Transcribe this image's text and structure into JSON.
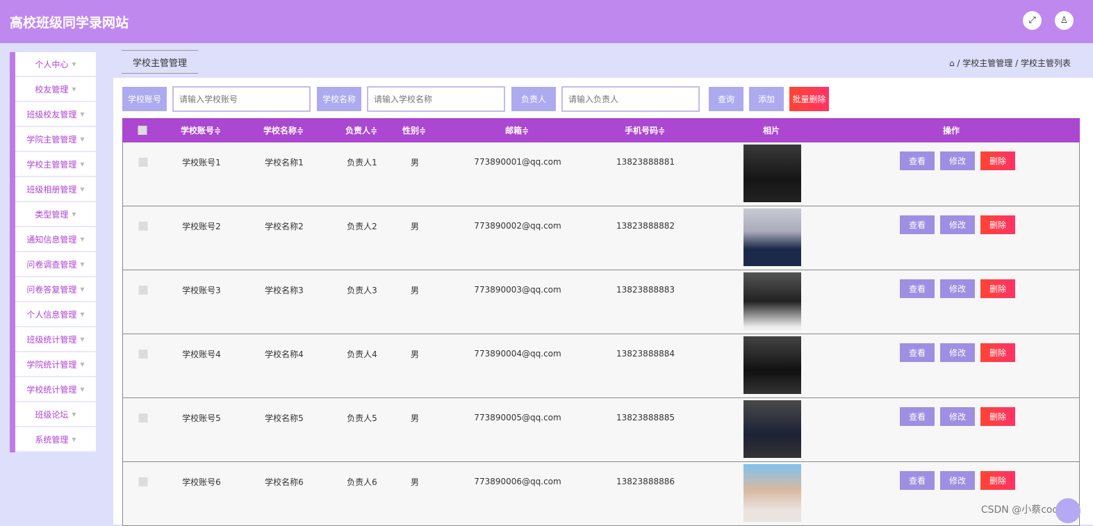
{
  "header": {
    "title": "高校班级同学录网站"
  },
  "sidebar": {
    "items": [
      "个人中心",
      "校友管理",
      "班级校友管理",
      "学院主管管理",
      "学校主管管理",
      "班级相册管理",
      "类型管理",
      "通知信息管理",
      "问卷调查管理",
      "问卷答复管理",
      "个人信息管理",
      "班级统计管理",
      "学院统计管理",
      "学校统计管理",
      "班级论坛",
      "系统管理"
    ]
  },
  "tab": "学校主管管理",
  "breadcrumb": {
    "items": [
      "学校主管管理",
      "学校主管列表"
    ],
    "sep": "/"
  },
  "search": {
    "f1_label": "学校账号",
    "f1_ph": "请输入学校账号",
    "f2_label": "学校名称",
    "f2_ph": "请输入学校名称",
    "f3_label": "负责人",
    "f3_ph": "请输入负责人",
    "query": "查询",
    "add": "添加",
    "batch_delete": "批量删除"
  },
  "table": {
    "headers": [
      "学校账号≑",
      "学校名称≑",
      "负责人≑",
      "性别≑",
      "邮箱≑",
      "手机号码≑",
      "相片",
      "操作"
    ],
    "actions": {
      "view": "查看",
      "edit": "修改",
      "delete": "删除"
    },
    "rows": [
      {
        "account": "学校账号1",
        "name": "学校名称1",
        "owner": "负责人1",
        "gender": "男",
        "email": "773890001@qq.com",
        "phone": "13823888881"
      },
      {
        "account": "学校账号2",
        "name": "学校名称2",
        "owner": "负责人2",
        "gender": "男",
        "email": "773890002@qq.com",
        "phone": "13823888882"
      },
      {
        "account": "学校账号3",
        "name": "学校名称3",
        "owner": "负责人3",
        "gender": "男",
        "email": "773890003@qq.com",
        "phone": "13823888883"
      },
      {
        "account": "学校账号4",
        "name": "学校名称4",
        "owner": "负责人4",
        "gender": "男",
        "email": "773890004@qq.com",
        "phone": "13823888884"
      },
      {
        "account": "学校账号5",
        "name": "学校名称5",
        "owner": "负责人5",
        "gender": "男",
        "email": "773890005@qq.com",
        "phone": "13823888885"
      },
      {
        "account": "学校账号6",
        "name": "学校名称6",
        "owner": "负责人6",
        "gender": "男",
        "email": "773890006@qq.com",
        "phone": "13823888886"
      }
    ]
  },
  "watermark": "CSDN @小蔡coding"
}
